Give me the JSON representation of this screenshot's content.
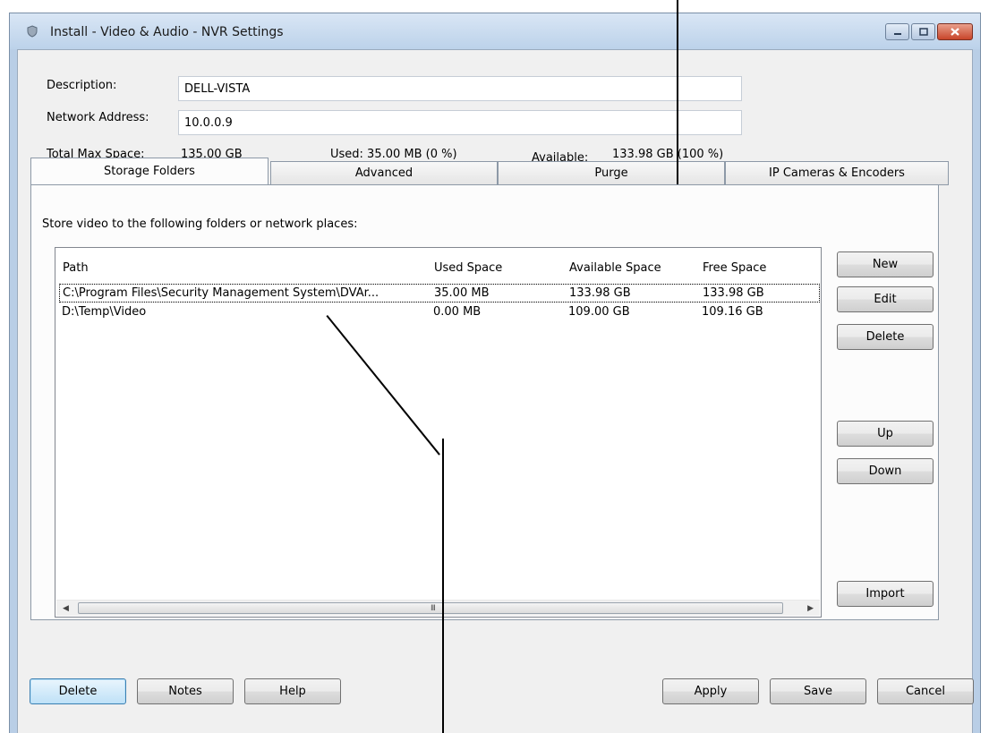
{
  "window": {
    "title": "Install - Video & Audio - NVR Settings"
  },
  "form": {
    "description_label": "Description:",
    "description_value": "DELL-VISTA",
    "network_label": "Network Address:",
    "network_value": "10.0.0.9",
    "total_label": "Total Max Space:",
    "total_value": "135.00 GB",
    "used_text": "Used: 35.00 MB (0 %)",
    "available_label": "Available:",
    "available_value": "133.98 GB (100 %)"
  },
  "tabs": [
    {
      "label": "Storage Folders",
      "active": true
    },
    {
      "label": "Advanced",
      "active": false
    },
    {
      "label": "Purge",
      "active": false
    },
    {
      "label": "IP Cameras & Encoders",
      "active": false
    }
  ],
  "storage": {
    "instruction": "Store video to the following folders or network places:",
    "columns": [
      "Path",
      "Used Space",
      "Available Space",
      "Free Space"
    ],
    "rows": [
      {
        "path": "C:\\Program Files\\Security Management System\\DVAr...",
        "used": "35.00 MB",
        "available": "133.98 GB",
        "free": "133.98 GB",
        "selected": true
      },
      {
        "path": "D:\\Temp\\Video",
        "used": "0.00 MB",
        "available": "109.00 GB",
        "free": "109.16 GB",
        "selected": false
      }
    ],
    "scroll_grip": "III"
  },
  "side_buttons": {
    "new": "New",
    "edit": "Edit",
    "delete": "Delete",
    "up": "Up",
    "down": "Down",
    "import": "Import"
  },
  "bottom_buttons": {
    "delete": "Delete",
    "notes": "Notes",
    "help": "Help",
    "apply": "Apply",
    "save": "Save",
    "cancel": "Cancel"
  },
  "icons": {
    "app": "shield-icon",
    "minimize": "minimize-icon",
    "maximize": "maximize-icon",
    "close": "close-icon",
    "scroll_left": "scroll-left-arrow-icon",
    "scroll_right": "scroll-right-arrow-icon"
  },
  "colors": {
    "window_frame": "#b9cee6",
    "client_bg": "#f0f0f0",
    "close_button": "#c8452a",
    "default_button": "#bfe1f7"
  }
}
